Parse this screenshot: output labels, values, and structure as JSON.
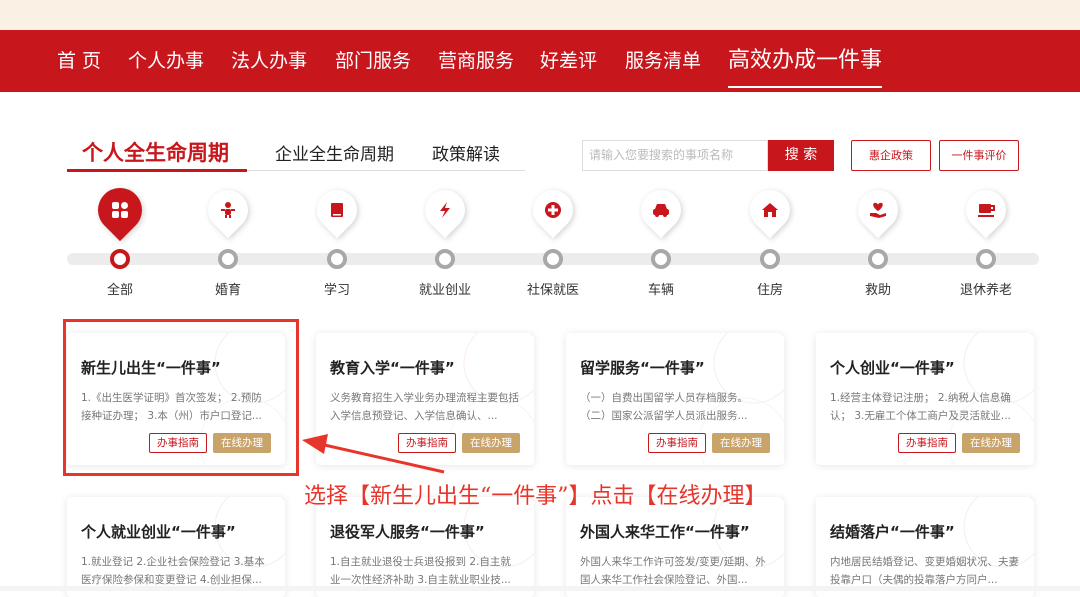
{
  "nav": {
    "items": [
      "首 页",
      "个人办事",
      "法人办事",
      "部门服务",
      "营商服务",
      "好差评",
      "服务清单",
      "高效办成一件事"
    ]
  },
  "tabs": [
    "个人全生命周期",
    "企业全生命周期",
    "政策解读"
  ],
  "search": {
    "placeholder": "请输入您要搜索的事项名称",
    "button": "搜 索",
    "policy_button": "惠企政策",
    "rating_button": "一件事评价"
  },
  "categories": [
    {
      "label": "全部",
      "icon": "grid-icon"
    },
    {
      "label": "婚育",
      "icon": "baby-icon"
    },
    {
      "label": "学习",
      "icon": "book-icon"
    },
    {
      "label": "就业创业",
      "icon": "briefcase-icon"
    },
    {
      "label": "社保就医",
      "icon": "medical-cross-icon"
    },
    {
      "label": "车辆",
      "icon": "car-icon"
    },
    {
      "label": "住房",
      "icon": "house-icon"
    },
    {
      "label": "救助",
      "icon": "heart-hand-icon"
    },
    {
      "label": "退休养老",
      "icon": "teacup-icon"
    }
  ],
  "cards": [
    {
      "title": "新生儿出生“一件事”",
      "desc": "1.《出生医学证明》首次签发； 2.预防接种证办理； 3.本（州）市户口登记...",
      "guide": "办事指南",
      "online": "在线办理"
    },
    {
      "title": "教育入学“一件事”",
      "desc": "义务教育招生入学业务办理流程主要包括入学信息预登记、入学信息确认、...",
      "guide": "办事指南",
      "online": "在线办理"
    },
    {
      "title": "留学服务“一件事”",
      "desc": "（一）自费出国留学人员存档服务。 （二）国家公派留学人员派出服务...",
      "guide": "办事指南",
      "online": "在线办理"
    },
    {
      "title": "个人创业“一件事”",
      "desc": "1.经营主体登记注册； 2.纳税人信息确认； 3.无雇工个体工商户及灵活就业...",
      "guide": "办事指南",
      "online": "在线办理"
    },
    {
      "title": "个人就业创业“一件事”",
      "desc": "1.就业登记 2.企业社会保险登记 3.基本医疗保险参保和变更登记 4.创业担保..."
    },
    {
      "title": "退役军人服务“一件事”",
      "desc": "1.自主就业退役士兵退役报到 2.自主就业一次性经济补助 3.自主就业职业技..."
    },
    {
      "title": "外国人来华工作“一件事”",
      "desc": "外国人来华工作许可签发/变更/延期、外国人来华工作社会保险登记、外国..."
    },
    {
      "title": "结婚落户“一件事”",
      "desc": "内地居民结婚登记、变更婚姻状况、夫妻投靠户口（夫偶的投靠落户方同户..."
    }
  ],
  "annotation": "选择【新生儿出生“一件事”】点击【在线办理】",
  "colors": {
    "brand": "#c8161d",
    "accent": "#c9a46a",
    "annotation": "#e8352b"
  }
}
